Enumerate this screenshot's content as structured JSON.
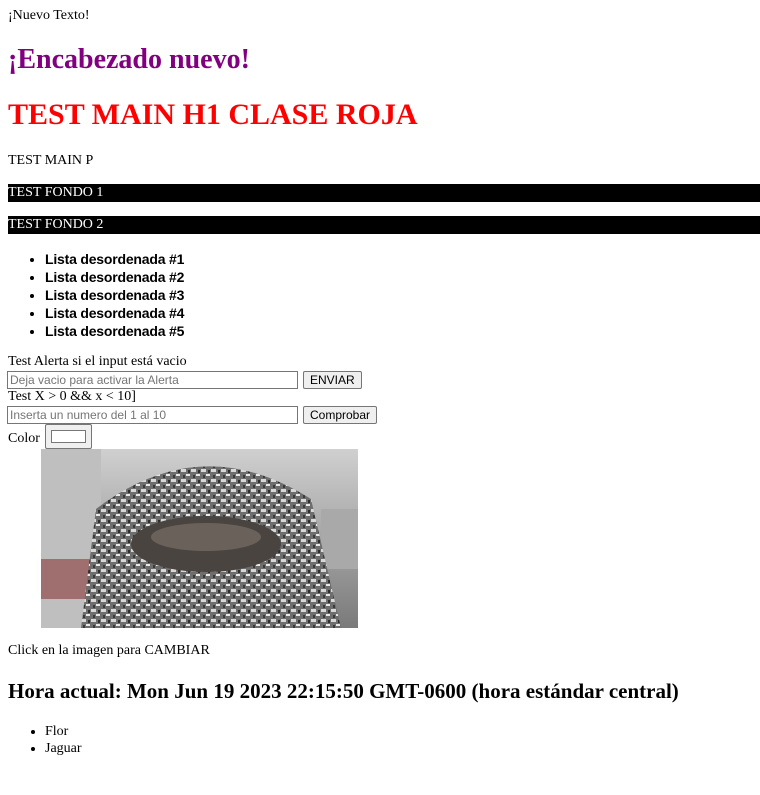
{
  "nuevo_texto": "¡Nuevo Texto!",
  "encabezado": "¡Encabezado nuevo!",
  "h1_roja": "TEST MAIN H1 CLASE ROJA",
  "main_p": "TEST MAIN P",
  "fondo1": "TEST FONDO 1",
  "fondo2": "TEST FONDO 2",
  "lista_desordenada": [
    "Lista desordenada #1",
    "Lista desordenada #2",
    "Lista desordenada #3",
    "Lista desordenada #4",
    "Lista desordenada #5"
  ],
  "alert_form": {
    "label": "Test Alerta si el input está vacio",
    "placeholder": "Deja vacio para activar la Alerta",
    "value": "",
    "button": "ENVIAR"
  },
  "range_form": {
    "label": "Test X > 0 && x < 10]",
    "placeholder": "Inserta un numero del 1 al 10",
    "value": "",
    "button": "Comprobar"
  },
  "color": {
    "label": "Color",
    "value": "#ffffff"
  },
  "image_caption": "Click en la imagen para CAMBIAR",
  "hora": "Hora actual: Mon Jun 19 2023 22:15:50 GMT-0600 (hora estándar central)",
  "lista_final": [
    "Flor",
    "Jaguar"
  ]
}
